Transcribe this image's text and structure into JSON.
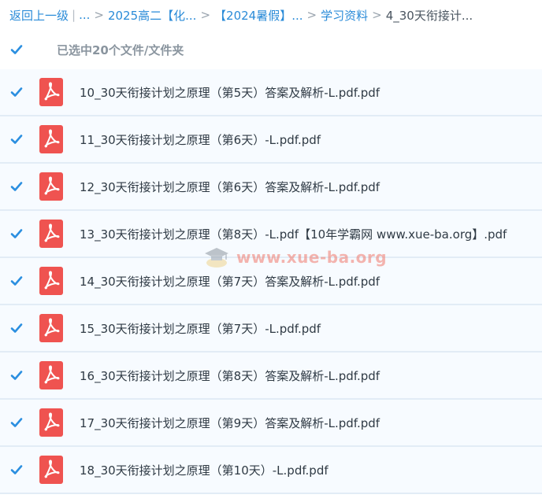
{
  "breadcrumb": {
    "back": "返回上一级",
    "ellipsis": "...",
    "items": [
      "2025高二【化...",
      "【2024暑假】...",
      "学习资料"
    ],
    "current": "4_30天衔接计..."
  },
  "selection": {
    "label": "已选中20个文件/文件夹",
    "all_checked": true
  },
  "files": [
    {
      "name": "10_30天衔接计划之原理（第5天）答案及解析-L.pdf.pdf",
      "icon": "pdf-icon",
      "checked": true
    },
    {
      "name": "11_30天衔接计划之原理（第6天）-L.pdf.pdf",
      "icon": "pdf-icon",
      "checked": true
    },
    {
      "name": "12_30天衔接计划之原理（第6天）答案及解析-L.pdf.pdf",
      "icon": "pdf-icon",
      "checked": true
    },
    {
      "name": "13_30天衔接计划之原理（第8天）-L.pdf【10年学霸网 www.xue-ba.org】.pdf",
      "icon": "pdf-icon",
      "checked": true
    },
    {
      "name": "14_30天衔接计划之原理（第7天）答案及解析-L.pdf.pdf",
      "icon": "pdf-icon",
      "checked": true
    },
    {
      "name": "15_30天衔接计划之原理（第7天）-L.pdf.pdf",
      "icon": "pdf-icon",
      "checked": true
    },
    {
      "name": "16_30天衔接计划之原理（第8天）答案及解析-L.pdf.pdf",
      "icon": "pdf-icon",
      "checked": true
    },
    {
      "name": "17_30天衔接计划之原理（第9天）答案及解析-L.pdf.pdf",
      "icon": "pdf-icon",
      "checked": true
    },
    {
      "name": "18_30天衔接计划之原理（第10天）-L.pdf.pdf",
      "icon": "pdf-icon",
      "checked": true
    }
  ],
  "watermark": {
    "text": "www.xue-ba.org"
  },
  "colors": {
    "link": "#2a8bd8",
    "checkbox": "#2b8fe0",
    "pdf": "#ef5350",
    "row_bg": "#f7fbff",
    "row_border": "#e2ecf6"
  }
}
